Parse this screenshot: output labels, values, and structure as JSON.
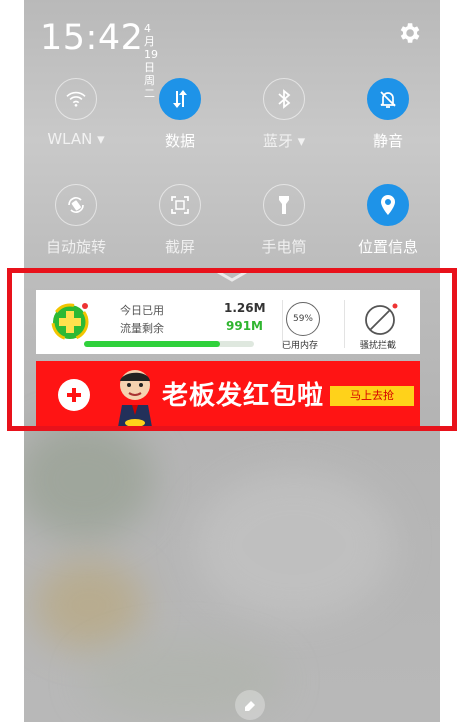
{
  "status": {
    "time": "15:42",
    "date": "4月19日",
    "weekday": "周二"
  },
  "quick_settings": {
    "row1": [
      {
        "label": "WLAN ▾",
        "icon": "wifi-icon",
        "active": false
      },
      {
        "label": "数据",
        "icon": "data-arrows-icon",
        "active": true
      },
      {
        "label": "蓝牙 ▾",
        "icon": "bluetooth-icon",
        "active": false
      },
      {
        "label": "静音",
        "icon": "mute-bell-icon",
        "active": true
      }
    ],
    "row2": [
      {
        "label": "自动旋转",
        "icon": "auto-rotate-icon",
        "active": false
      },
      {
        "label": "截屏",
        "icon": "screenshot-icon",
        "active": false
      },
      {
        "label": "手电筒",
        "icon": "flashlight-icon",
        "active": false
      },
      {
        "label": "位置信息",
        "icon": "location-icon",
        "active": true
      }
    ]
  },
  "notification": {
    "today_used_label": "今日已用",
    "today_used_value": "1.26M",
    "remaining_label": "流量剩余",
    "remaining_value": "991M",
    "remaining_progress_percent": 80,
    "memory_percent": "59%",
    "memory_label": "已用内存",
    "block_label": "骚扰拦截",
    "colors": {
      "progress": "#2fd13b",
      "remaining_value": "#2fb52f"
    }
  },
  "banner": {
    "title": "老板发红包啦",
    "button": "马上去抢",
    "colors": {
      "background": "#ff1414",
      "button": "#ffd21a"
    }
  }
}
